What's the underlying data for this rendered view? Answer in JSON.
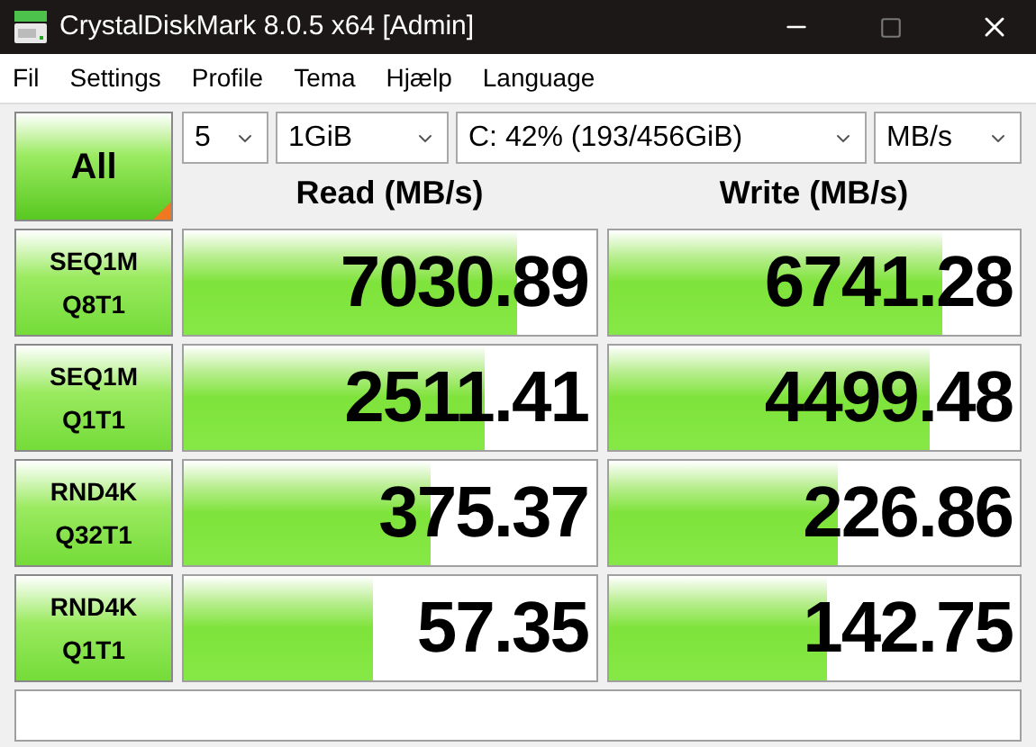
{
  "window": {
    "title": "CrystalDiskMark 8.0.5 x64 [Admin]"
  },
  "menu": [
    "Fil",
    "Settings",
    "Profile",
    "Tema",
    "Hjælp",
    "Language"
  ],
  "all_button": {
    "label": "All"
  },
  "selects": [
    {
      "value": "5"
    },
    {
      "value": "1GiB"
    },
    {
      "value": "C: 42% (193/456GiB)"
    },
    {
      "value": "MB/s"
    }
  ],
  "columns": [
    "Read (MB/s)",
    "Write (MB/s)"
  ],
  "rows": [
    {
      "test": [
        "SEQ1M",
        "Q8T1"
      ],
      "read": {
        "value": "7030.89",
        "level": 0.81
      },
      "write": {
        "value": "6741.28",
        "level": 0.81
      }
    },
    {
      "test": [
        "SEQ1M",
        "Q1T1"
      ],
      "read": {
        "value": "2511.41",
        "level": 0.73
      },
      "write": {
        "value": "4499.48",
        "level": 0.78
      }
    },
    {
      "test": [
        "RND4K",
        "Q32T1"
      ],
      "read": {
        "value": "375.37",
        "level": 0.6
      },
      "write": {
        "value": "226.86",
        "level": 0.56
      }
    },
    {
      "test": [
        "RND4K",
        "Q1T1"
      ],
      "read": {
        "value": "57.35",
        "level": 0.46
      },
      "write": {
        "value": "142.75",
        "level": 0.53
      }
    }
  ]
}
